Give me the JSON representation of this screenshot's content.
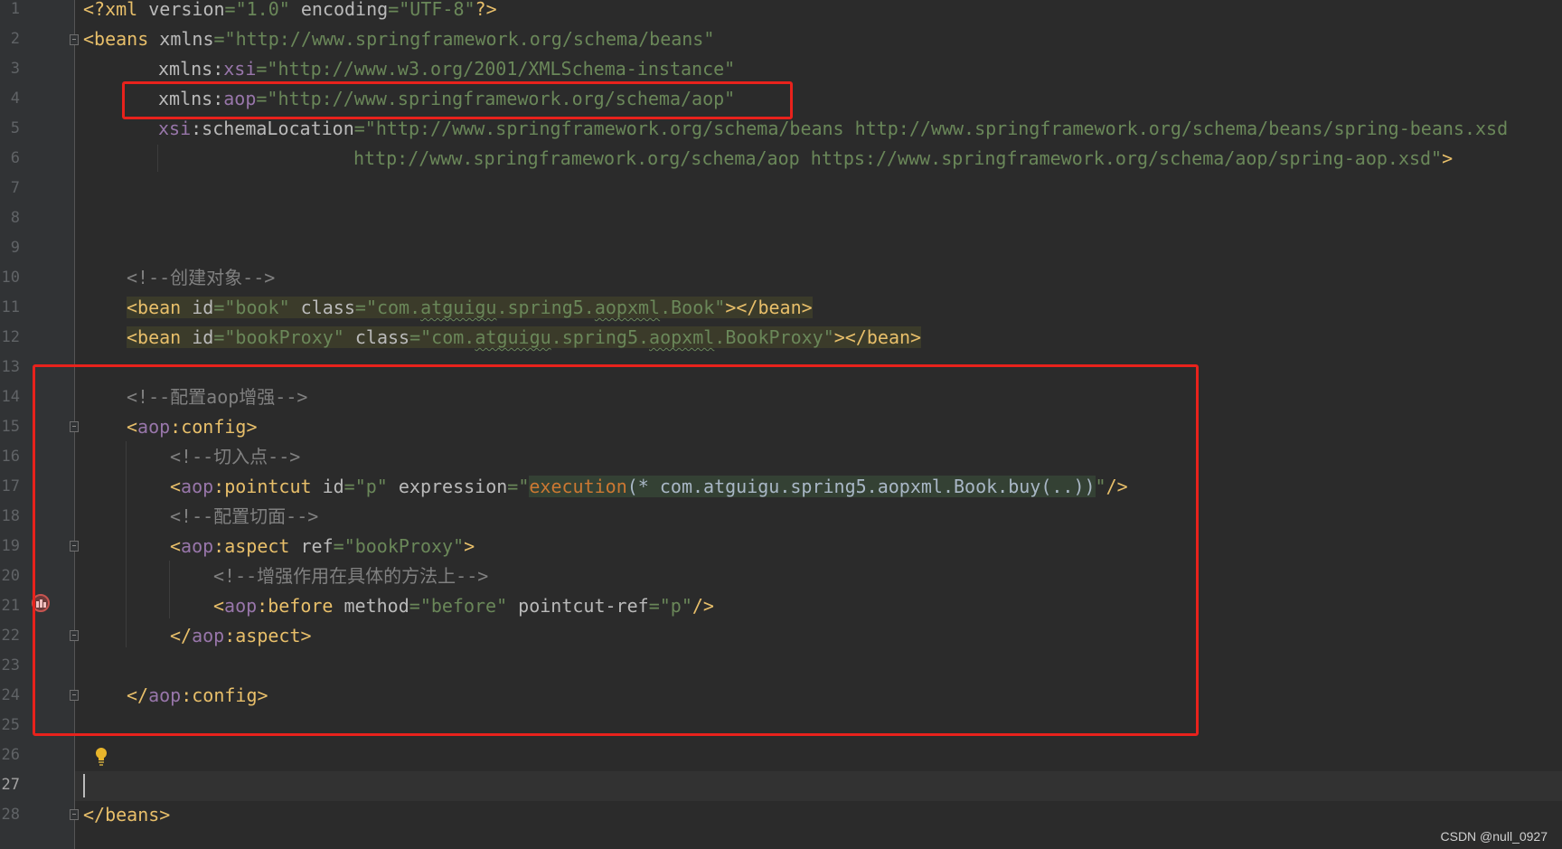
{
  "editor": {
    "language": "XML",
    "current_line": 27,
    "lines": [
      {
        "n": "1"
      },
      {
        "n": "2"
      },
      {
        "n": "3"
      },
      {
        "n": "4"
      },
      {
        "n": "5"
      },
      {
        "n": "6"
      },
      {
        "n": "7"
      },
      {
        "n": "8"
      },
      {
        "n": "9"
      },
      {
        "n": "10"
      },
      {
        "n": "11"
      },
      {
        "n": "12"
      },
      {
        "n": "13"
      },
      {
        "n": "14"
      },
      {
        "n": "15"
      },
      {
        "n": "16"
      },
      {
        "n": "17"
      },
      {
        "n": "18"
      },
      {
        "n": "19"
      },
      {
        "n": "20"
      },
      {
        "n": "21"
      },
      {
        "n": "22"
      },
      {
        "n": "23"
      },
      {
        "n": "24"
      },
      {
        "n": "25"
      },
      {
        "n": "26"
      },
      {
        "n": "27"
      },
      {
        "n": "28"
      }
    ],
    "code": {
      "l1_open": "<?xml",
      "l1_a1": " version",
      "l1_eq1": "=",
      "l1_v1": "\"1.0\"",
      "l1_a2": " encoding",
      "l1_eq2": "=",
      "l1_v2": "\"UTF-8\"",
      "l1_close": "?>",
      "l2_tag": "<beans",
      "l2_attr": " xmlns",
      "l2_eq": "=",
      "l2_val": "\"http://www.springframework.org/schema/beans\"",
      "l3_attr": "xmlns:",
      "l3_ns": "xsi",
      "l3_eq": "=",
      "l3_val": "\"http://www.w3.org/2001/XMLSchema-instance\"",
      "l4_attr": "xmlns:",
      "l4_ns": "aop",
      "l4_eq": "=",
      "l4_val": "\"http://www.springframework.org/schema/aop\"",
      "l5_ns": "xsi",
      "l5_attr": ":schemaLocation",
      "l5_eq": "=",
      "l5_val": "\"http://www.springframework.org/schema/beans http://www.springframework.org/schema/beans/spring-beans.xsd",
      "l6_val": "http://www.springframework.org/schema/aop https://www.springframework.org/schema/aop/spring-aop.xsd\"",
      "l6_close": ">",
      "l10_comment": "<!--创建对象-->",
      "l11_tag": "<bean",
      "l11_a1": " id",
      "l11_eq1": "=",
      "l11_v1": "\"book\"",
      "l11_a2": " class",
      "l11_eq2": "=",
      "l11_v2a": "\"com.",
      "l11_v2b": "atguigu",
      "l11_v2c": ".spring5.",
      "l11_v2d": "aopxml",
      "l11_v2e": ".Book\"",
      "l11_close": "></bean>",
      "l12_tag": "<bean",
      "l12_a1": " id",
      "l12_eq1": "=",
      "l12_v1": "\"bookProxy\"",
      "l12_a2": " class",
      "l12_eq2": "=",
      "l12_v2a": "\"com.",
      "l12_v2b": "atguigu",
      "l12_v2c": ".spring5.",
      "l12_v2d": "aopxml",
      "l12_v2e": ".BookProxy\"",
      "l12_close": "></bean>",
      "l14_comment": "<!--配置aop增强-->",
      "l15_lt": "<",
      "l15_ns": "aop",
      "l15_tag": ":config",
      "l15_gt": ">",
      "l16_comment": "<!--切入点-->",
      "l17_lt": "<",
      "l17_ns": "aop",
      "l17_tag": ":pointcut",
      "l17_a1": " id",
      "l17_eq1": "=",
      "l17_v1": "\"p\"",
      "l17_a2": " expression",
      "l17_eq2": "=",
      "l17_q1": "\"",
      "l17_exec": "execution",
      "l17_expr": "(* com.atguigu.spring5.aopxml.Book.buy(..))",
      "l17_q2": "\"",
      "l17_close": "/>",
      "l18_comment": "<!--配置切面-->",
      "l19_lt": "<",
      "l19_ns": "aop",
      "l19_tag": ":aspect",
      "l19_a1": " ref",
      "l19_eq1": "=",
      "l19_v1": "\"bookProxy\"",
      "l19_gt": ">",
      "l20_comment": "<!--增强作用在具体的方法上-->",
      "l21_lt": "<",
      "l21_ns": "aop",
      "l21_tag": ":before",
      "l21_a1": " method",
      "l21_eq1": "=",
      "l21_v1": "\"before\"",
      "l21_a2": " pointcut-ref",
      "l21_eq2": "=",
      "l21_v2": "\"p\"",
      "l21_close": "/>",
      "l22_lt": "</",
      "l22_ns": "aop",
      "l22_tag": ":aspect",
      "l22_gt": ">",
      "l24_lt": "</",
      "l24_ns": "aop",
      "l24_tag": ":config",
      "l24_gt": ">",
      "l28_tag": "</beans>"
    }
  },
  "icons": {
    "fold": "fold-marker-icon",
    "bulb": "lightbulb-icon",
    "breakpoint": "aop-advice-gutter-icon"
  },
  "colors": {
    "background": "#2b2b2b",
    "tag": "#e8bf6a",
    "string": "#6a8759",
    "namespace": "#9876aa",
    "comment": "#808080",
    "annotation_box": "#e8221c"
  },
  "watermark": "CSDN @null_0927"
}
